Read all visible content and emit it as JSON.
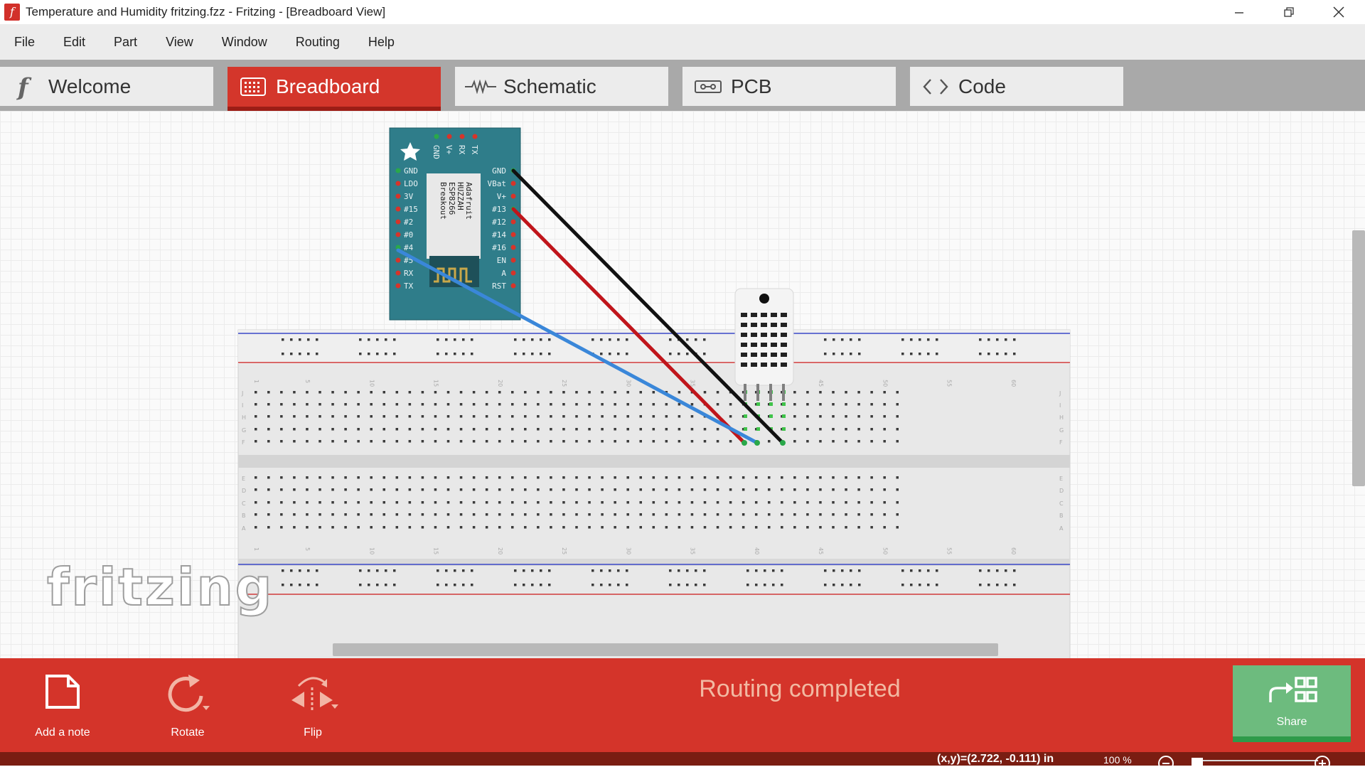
{
  "window": {
    "title": "Temperature and Humidity fritzing.fzz - Fritzing - [Breadboard View]",
    "app_icon_letter": "f",
    "controls": [
      "minimize-icon",
      "restore-icon",
      "close-icon"
    ]
  },
  "menu": [
    "File",
    "Edit",
    "Part",
    "View",
    "Window",
    "Routing",
    "Help"
  ],
  "tabs": [
    {
      "label": "Welcome",
      "icon": "fritzing-f-icon",
      "active": false
    },
    {
      "label": "Breadboard",
      "icon": "breadboard-icon",
      "active": true
    },
    {
      "label": "Schematic",
      "icon": "resistor-zigzag-icon",
      "active": false
    },
    {
      "label": "PCB",
      "icon": "pcb-icon",
      "active": false
    },
    {
      "label": "Code",
      "icon": "code-brackets-icon",
      "active": false
    }
  ],
  "canvas": {
    "logo_text": "fritzing",
    "esp_board": {
      "text": [
        "Adafruit",
        "HUZZAH",
        "ESP8266",
        "Breakout"
      ],
      "top_pins": [
        "GND",
        "V+",
        "RX",
        "TX"
      ],
      "left_pins": [
        "GND",
        "LDO",
        "3V",
        "#15",
        "#2",
        "#0",
        "#4",
        "#5",
        "RX",
        "TX"
      ],
      "right_pins": [
        "GND",
        "VBat",
        "V+",
        "#13",
        "#12",
        "#14",
        "#16",
        "EN",
        "A",
        "RST"
      ]
    },
    "breadboard": {
      "column_numbers": [
        "1",
        "5",
        "10",
        "15",
        "20",
        "25",
        "30",
        "35",
        "40",
        "45",
        "50",
        "55",
        "60"
      ],
      "rows_top": [
        "J",
        "I",
        "H",
        "G",
        "F"
      ],
      "rows_bottom": [
        "E",
        "D",
        "C",
        "B",
        "A"
      ]
    },
    "wires": [
      {
        "color": "#111111",
        "name": "black-wire"
      },
      {
        "color": "#c0151b",
        "name": "red-wire"
      },
      {
        "color": "#3a87d9",
        "name": "blue-wire"
      }
    ]
  },
  "toolbar": {
    "add_note": "Add a note",
    "rotate": "Rotate",
    "flip": "Flip",
    "status": "Routing completed",
    "share": "Share"
  },
  "statusbar": {
    "coords": "(x,y)=(2.722, -0.111) in",
    "zoom": "100 %"
  },
  "colors": {
    "accent_red": "#d4342a",
    "share_green": "#6dbb7e",
    "board_teal": "#2f7d8a"
  }
}
